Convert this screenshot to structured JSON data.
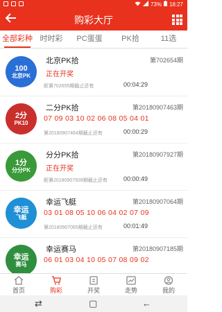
{
  "status_bar": {
    "signal": "◆",
    "battery_pct": "73%",
    "time": "18:27"
  },
  "header": {
    "title": "购彩大厅"
  },
  "tabs": [
    "全部彩种",
    "时时彩",
    "PC蛋蛋",
    "PK拾",
    "11选"
  ],
  "items": [
    {
      "name": "北京PK拾",
      "issue": "第702654期",
      "logo_big": "100",
      "logo_small": "北京PK",
      "logo_color": "#2a6fd6",
      "status": "正在开奖",
      "numbers": "",
      "deadline": "距第702655期截止还有",
      "countdown": "00:04:29"
    },
    {
      "name": "二分PK拾",
      "issue": "第20180907463期",
      "logo_big": "2分",
      "logo_small": "PK10",
      "logo_color": "#c9302c",
      "status": "",
      "numbers": "07 09 03 10 02 06 08 05 04 01",
      "deadline": "第20180907464期截止还有",
      "countdown": "00:00:29"
    },
    {
      "name": "分分PK拾",
      "issue": "第20180907927期",
      "logo_big": "1分",
      "logo_small": "分分PK",
      "logo_color": "#3a9a3a",
      "status": "正在开奖",
      "numbers": "",
      "deadline": "距第20180907928期截止还有",
      "countdown": "00:00:49"
    },
    {
      "name": "幸运飞艇",
      "issue": "第20180907064期",
      "logo_big": "幸运",
      "logo_small": "飞艇",
      "logo_color": "#1f8fd6",
      "status": "",
      "numbers": "03 01 08 05 10 06 04 02 07 09",
      "deadline": "第20180907065期截止还有",
      "countdown": "00:01:49"
    },
    {
      "name": "幸运赛马",
      "issue": "第20180907185期",
      "logo_big": "幸运",
      "logo_small": "赛马",
      "logo_color": "#2f8f3f",
      "status": "",
      "numbers": "06 01 03 04 10 05 07 08 09 02",
      "deadline": "",
      "countdown": ""
    }
  ],
  "bottom_nav": [
    {
      "label": "首页",
      "icon": "home-icon"
    },
    {
      "label": "购彩",
      "icon": "cart-icon"
    },
    {
      "label": "开奖",
      "icon": "trophy-icon"
    },
    {
      "label": "走势",
      "icon": "chart-icon"
    },
    {
      "label": "我的",
      "icon": "user-icon"
    }
  ],
  "sys_nav": {
    "recent": "⇄",
    "home": "▢",
    "back": "←"
  },
  "colors": {
    "accent": "#e8321e"
  }
}
